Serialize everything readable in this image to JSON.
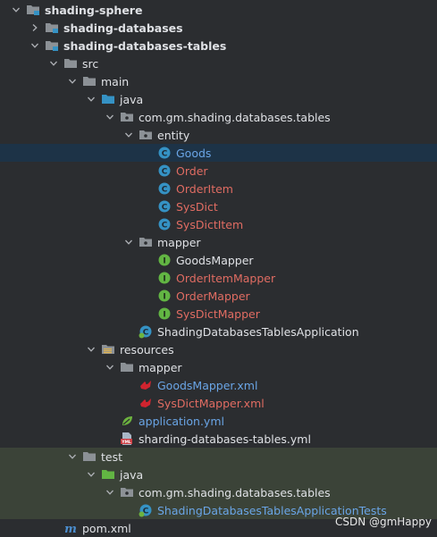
{
  "tree": {
    "rows": [
      {
        "label": "shading-sphere",
        "style": "bold",
        "icon": "module-folder-icon",
        "state": "expanded"
      },
      {
        "label": "shading-databases",
        "style": "bold",
        "icon": "module-folder-icon",
        "state": "collapsed"
      },
      {
        "label": "shading-databases-tables",
        "style": "bold",
        "icon": "module-folder-icon",
        "state": "expanded"
      },
      {
        "label": "src",
        "style": "normal",
        "icon": "folder-icon",
        "state": "expanded"
      },
      {
        "label": "main",
        "style": "normal",
        "icon": "folder-icon",
        "state": "expanded"
      },
      {
        "label": "java",
        "style": "normal",
        "icon": "source-root-folder-icon",
        "state": "expanded"
      },
      {
        "label": "com.gm.shading.databases.tables",
        "style": "normal",
        "icon": "package-icon",
        "state": "expanded"
      },
      {
        "label": "entity",
        "style": "normal",
        "icon": "package-icon",
        "state": "expanded"
      },
      {
        "label": "Goods",
        "style": "blue",
        "icon": "class-icon",
        "state": "none",
        "selected": true
      },
      {
        "label": "Order",
        "style": "red",
        "icon": "class-icon",
        "state": "none"
      },
      {
        "label": "OrderItem",
        "style": "red",
        "icon": "class-icon",
        "state": "none"
      },
      {
        "label": "SysDict",
        "style": "red",
        "icon": "class-icon",
        "state": "none"
      },
      {
        "label": "SysDictItem",
        "style": "red",
        "icon": "class-icon",
        "state": "none"
      },
      {
        "label": "mapper",
        "style": "normal",
        "icon": "package-icon",
        "state": "expanded"
      },
      {
        "label": "GoodsMapper",
        "style": "normal",
        "icon": "interface-icon",
        "state": "none"
      },
      {
        "label": "OrderItemMapper",
        "style": "red",
        "icon": "interface-icon",
        "state": "none"
      },
      {
        "label": "OrderMapper",
        "style": "red",
        "icon": "interface-icon",
        "state": "none"
      },
      {
        "label": "SysDictMapper",
        "style": "red",
        "icon": "interface-icon",
        "state": "none"
      },
      {
        "label": "ShadingDatabasesTablesApplication",
        "style": "normal",
        "icon": "spring-boot-app-class-icon",
        "state": "none"
      },
      {
        "label": "resources",
        "style": "normal",
        "icon": "resources-folder-icon",
        "state": "expanded"
      },
      {
        "label": "mapper",
        "style": "normal",
        "icon": "folder-icon",
        "state": "expanded"
      },
      {
        "label": "GoodsMapper.xml",
        "style": "blue",
        "icon": "mybatis-xml-icon",
        "state": "none"
      },
      {
        "label": "SysDictMapper.xml",
        "style": "red",
        "icon": "mybatis-xml-icon",
        "state": "none"
      },
      {
        "label": "application.yml",
        "style": "blue",
        "icon": "spring-config-icon",
        "state": "none"
      },
      {
        "label": "sharding-databases-tables.yml",
        "style": "normal",
        "icon": "yaml-file-icon",
        "state": "none"
      },
      {
        "label": "test",
        "style": "normal",
        "icon": "folder-icon",
        "state": "expanded",
        "band": true
      },
      {
        "label": "java",
        "style": "normal",
        "icon": "test-root-folder-icon",
        "state": "expanded",
        "band": true
      },
      {
        "label": "com.gm.shading.databases.tables",
        "style": "normal",
        "icon": "package-icon",
        "state": "expanded",
        "band": true
      },
      {
        "label": "ShadingDatabasesTablesApplicationTests",
        "style": "blue",
        "icon": "spring-boot-test-class-icon",
        "state": "none",
        "band": true
      },
      {
        "label": "pom.xml",
        "style": "normal",
        "icon": "maven-pom-icon",
        "state": "none"
      }
    ]
  },
  "watermark": "CSDN @gmHappy",
  "colors": {
    "background": "#2b2d30",
    "selection": "#1d3347",
    "test_band": "#3b4338",
    "modified_red": "#e06c62",
    "new_blue": "#6aa5e6",
    "text": "#dfe1e5",
    "class_icon": "#3592c4",
    "interface_icon": "#62b543",
    "source_root_blue": "#3592c4",
    "test_root_green": "#62b543"
  }
}
